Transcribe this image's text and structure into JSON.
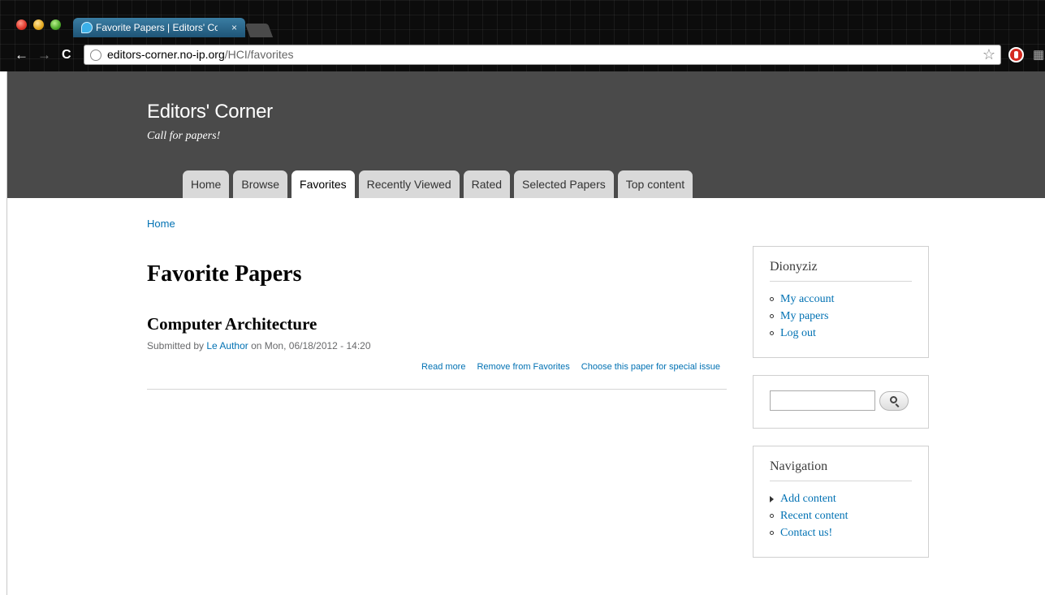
{
  "browser": {
    "tab_title": "Favorite Papers | Editors' Corner",
    "tab_close": "×",
    "url_host": "editors-corner.no-ip.org",
    "url_path": "/HCI/favorites",
    "back": "←",
    "forward": "→",
    "reload": "C",
    "star": "☆",
    "extension_2": "▦"
  },
  "header": {
    "site_name": "Editors' Corner",
    "slogan": "Call for papers!",
    "tabs": [
      {
        "label": "Home"
      },
      {
        "label": "Browse"
      },
      {
        "label": "Favorites"
      },
      {
        "label": "Recently Viewed"
      },
      {
        "label": "Rated"
      },
      {
        "label": "Selected Papers"
      },
      {
        "label": "Top content"
      }
    ]
  },
  "breadcrumb": "Home",
  "page_title": "Favorite Papers",
  "node": {
    "title": "Computer Architecture",
    "submitted_prefix": "Submitted by ",
    "author": "Le Author",
    "submitted_suffix": " on Mon, 06/18/2012 - 14:20",
    "links": [
      "Read more",
      "Remove from Favorites",
      "Choose this paper for special issue"
    ]
  },
  "sidebar": {
    "user_block": {
      "title": "Dionyziz",
      "items": [
        "My account",
        "My papers",
        "Log out"
      ]
    },
    "search": {
      "value": "",
      "placeholder": ""
    },
    "navigation": {
      "title": "Navigation",
      "items": [
        "Add content",
        "Recent content",
        "Contact us!"
      ]
    }
  },
  "colors": {
    "link": "#0071b3",
    "header_bg": "#4a4a4a",
    "tab_bg": "#d9d9d9"
  }
}
